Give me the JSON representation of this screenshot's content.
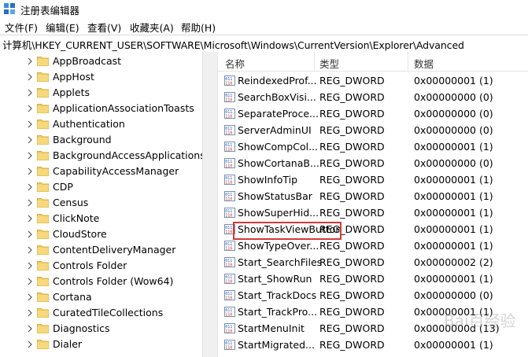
{
  "window": {
    "title": "注册表编辑器"
  },
  "menu": [
    "文件(F)",
    "编辑(E)",
    "查看(V)",
    "收藏夹(A)",
    "帮助(H)"
  ],
  "address": "计算机\\HKEY_CURRENT_USER\\SOFTWARE\\Microsoft\\Windows\\CurrentVersion\\Explorer\\Advanced",
  "tree": [
    "AppBroadcast",
    "AppHost",
    "Applets",
    "ApplicationAssociationToasts",
    "Authentication",
    "Background",
    "BackgroundAccessApplications",
    "CapabilityAccessManager",
    "CDP",
    "Census",
    "ClickNote",
    "CloudStore",
    "ContentDeliveryManager",
    "Controls Folder",
    "Controls Folder (Wow64)",
    "Cortana",
    "CuratedTileCollections",
    "Diagnostics",
    "Dialer"
  ],
  "columns": {
    "name": "名称",
    "type": "类型",
    "data": "数据"
  },
  "values": [
    {
      "name": "ReindexedProf...",
      "type": "REG_DWORD",
      "data": "0x00000001 (1)"
    },
    {
      "name": "SearchBoxVisi...",
      "type": "REG_DWORD",
      "data": "0x00000000 (0)"
    },
    {
      "name": "SeparateProce...",
      "type": "REG_DWORD",
      "data": "0x00000000 (0)"
    },
    {
      "name": "ServerAdminUI",
      "type": "REG_DWORD",
      "data": "0x00000000 (0)"
    },
    {
      "name": "ShowCompCol...",
      "type": "REG_DWORD",
      "data": "0x00000001 (1)"
    },
    {
      "name": "ShowCortanaB...",
      "type": "REG_DWORD",
      "data": "0x00000000 (0)"
    },
    {
      "name": "ShowInfoTip",
      "type": "REG_DWORD",
      "data": "0x00000001 (1)"
    },
    {
      "name": "ShowStatusBar",
      "type": "REG_DWORD",
      "data": "0x00000001 (1)"
    },
    {
      "name": "ShowSuperHid...",
      "type": "REG_DWORD",
      "data": "0x00000001 (1)"
    },
    {
      "name": "ShowTaskViewButton",
      "type": "REG_DWORD",
      "data": "0x00000001 (1)"
    },
    {
      "name": "ShowTypeOver...",
      "type": "REG_DWORD",
      "data": "0x00000001 (1)"
    },
    {
      "name": "Start_SearchFiles",
      "type": "REG_DWORD",
      "data": "0x00000002 (2)"
    },
    {
      "name": "Start_ShowRun",
      "type": "REG_DWORD",
      "data": "0x00000001 (1)"
    },
    {
      "name": "Start_TrackDocs",
      "type": "REG_DWORD",
      "data": "0x00000000 (0)"
    },
    {
      "name": "Start_TrackPro...",
      "type": "REG_DWORD",
      "data": "0x00000001 (1)"
    },
    {
      "name": "StartMenuInit",
      "type": "REG_DWORD",
      "data": "0x0000000d (13)"
    },
    {
      "name": "StartMigrated...",
      "type": "REG_DWORD",
      "data": "0x00000001 (1)"
    }
  ],
  "highlighted": "ShowTaskViewButton",
  "colors": {
    "highlight_border": "#d23a3a",
    "folder": "#e8c25a",
    "reg_icon": "#2b5fb3"
  }
}
